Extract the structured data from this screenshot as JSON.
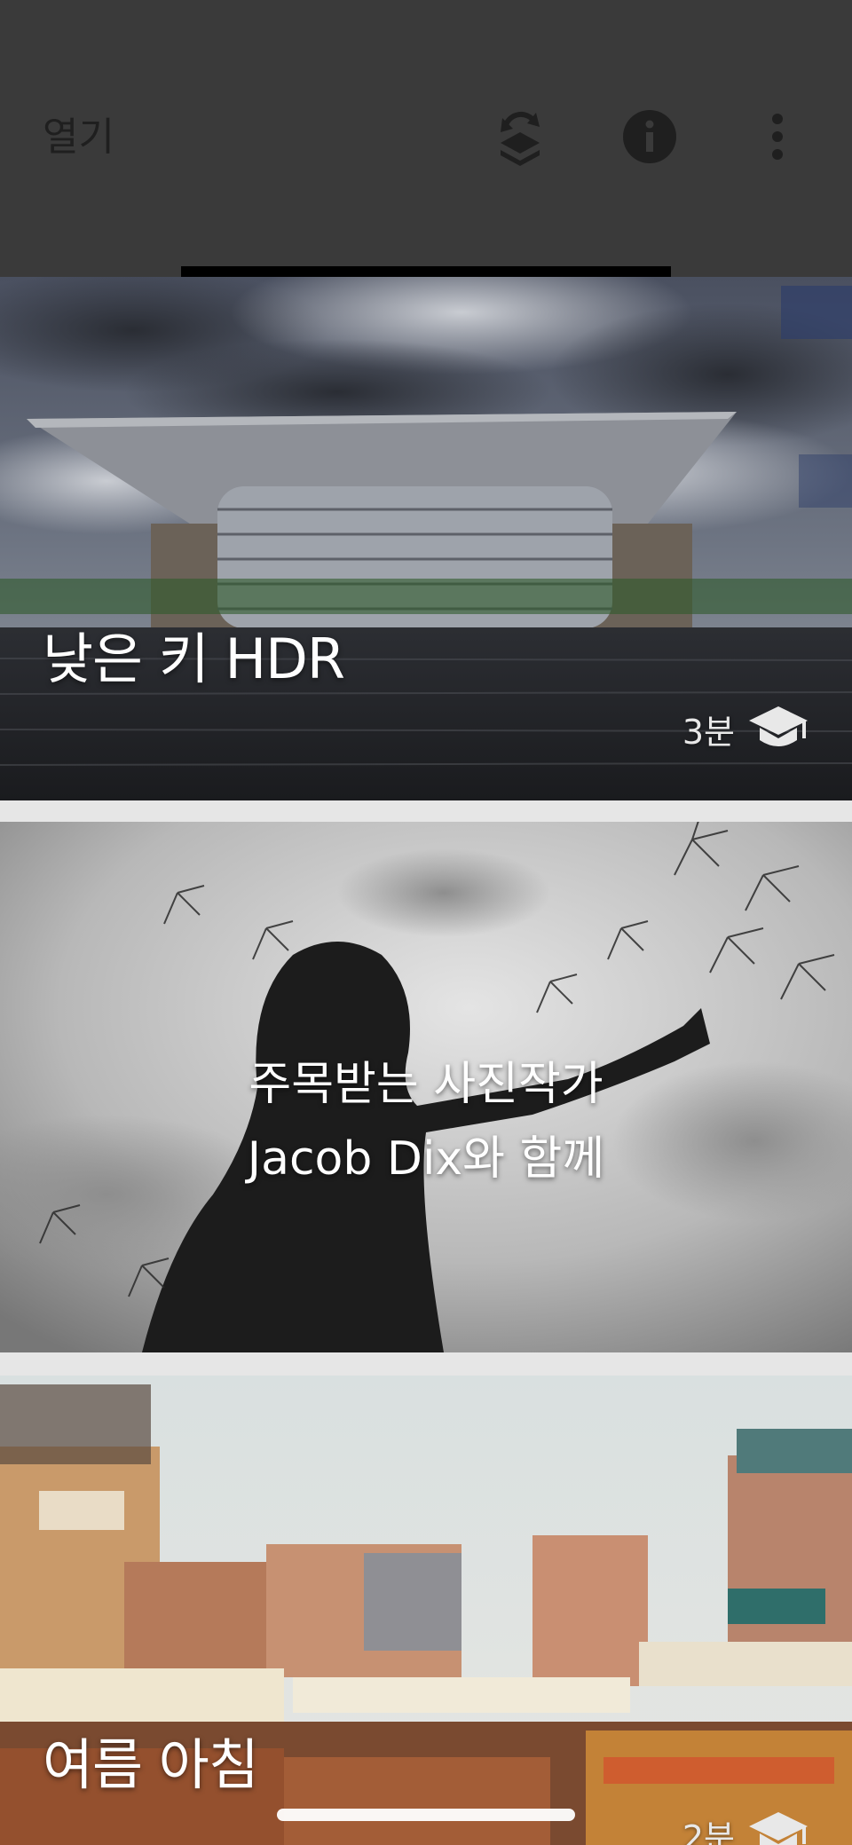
{
  "topbar": {
    "open_label": "열기",
    "icons": [
      "layers-refresh-icon",
      "info-icon",
      "more-vert-icon"
    ]
  },
  "cards": [
    {
      "title": "낮은 키 HDR",
      "duration": "3분",
      "duration_icon": "graduation-cap-icon"
    },
    {
      "title_line1": "주목받는 사진작가",
      "title_line2": "Jacob Dix와 함께"
    },
    {
      "title": "여름 아침",
      "duration": "2분",
      "duration_icon": "graduation-cap-icon"
    }
  ],
  "colors": {
    "topbar_bg": "#3a3a3a",
    "tab_indicator": "#000000",
    "card_gap": "#e6e6e6"
  }
}
